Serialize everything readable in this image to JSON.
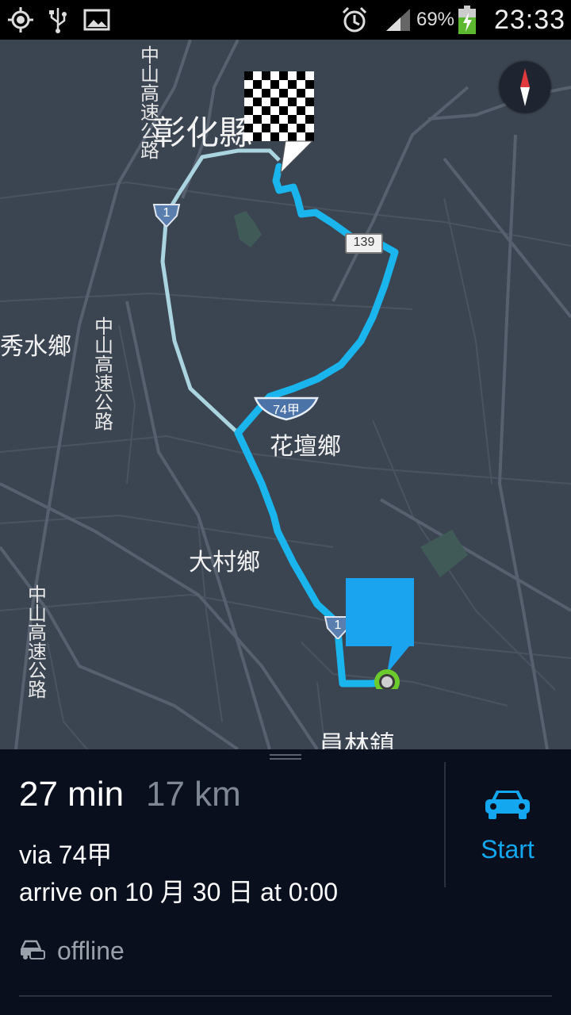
{
  "status_bar": {
    "battery_percent": "69%",
    "time": "23:33",
    "icons": [
      "gps-icon",
      "usb-icon",
      "gallery-icon",
      "alarm-icon",
      "signal-icon",
      "battery-charging-icon"
    ]
  },
  "map": {
    "place_labels": {
      "changhua_city": "彰化縣",
      "xiushui": "秀水鄉",
      "huatan": "花壇鄉",
      "dacun": "大村鄉",
      "yuanlin": "員林鎮"
    },
    "highway_labels": {
      "freeway_1": "中山高速公路",
      "freeway_2": "中山高速公路",
      "freeway_3": "中山高速公路"
    },
    "shields": {
      "route_139": "139",
      "route_74a": "74甲",
      "route_1_top": "1",
      "route_1_bottom": "1"
    },
    "colors": {
      "route_primary": "#19b5ec",
      "route_alternative": "#a9d4e0",
      "start_marker": "#6ccb2c",
      "background": "#3b4451"
    },
    "icons": [
      "compass-icon",
      "destination-flag-icon",
      "current-location-icon"
    ]
  },
  "route_panel": {
    "duration": "27 min",
    "distance": "17 km",
    "via": "via 74甲",
    "arrival": "arrive on 10 月 30 日 at 0:00",
    "status": "offline",
    "start_label": "Start",
    "accent_color": "#12a7ee"
  }
}
